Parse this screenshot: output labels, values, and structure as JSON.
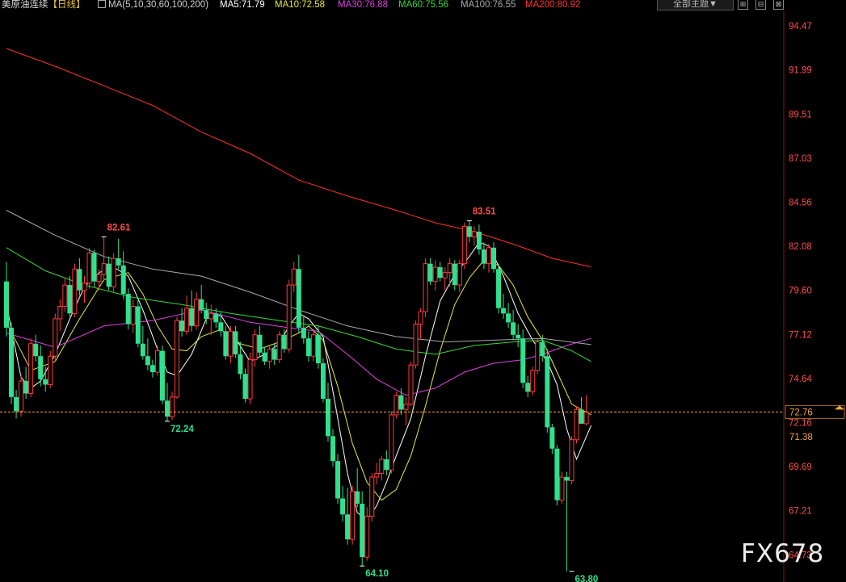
{
  "header": {
    "symbol": "美原油连续",
    "period": "【日线】",
    "ma_params": "MA(5,10,30,60,100,200)",
    "ma_values": [
      {
        "label": "MA5:71.79",
        "color": "#ffffff"
      },
      {
        "label": "MA10:72.58",
        "color": "#e8e83a"
      },
      {
        "label": "MA30:76.88",
        "color": "#e040e0"
      },
      {
        "label": "MA60:75.56",
        "color": "#38d838"
      },
      {
        "label": "MA100:76.55",
        "color": "#aaaaaa"
      },
      {
        "label": "MA200:80.92",
        "color": "#ff3030"
      }
    ],
    "theme_button": "全部主题▼",
    "window_buttons": [
      {
        "name": "expand-icon",
        "glyph": "⊞"
      },
      {
        "name": "minimize-window-icon",
        "glyph": "⊟"
      },
      {
        "name": "close-window-icon",
        "glyph": "⊠"
      }
    ]
  },
  "watermark": "FX678",
  "chart_data": {
    "type": "candlestick",
    "title": "美原油连续【日线】",
    "y_ticks": [
      94.47,
      91.99,
      89.51,
      87.03,
      84.56,
      82.08,
      79.6,
      77.12,
      74.64,
      72.16,
      69.69,
      67.21,
      64.73
    ],
    "ylim": [
      63.2,
      95.2
    ],
    "current_price": 72.76,
    "price_line_label": "72.76",
    "marker_price": 71.38,
    "marker_label": "71.38",
    "grid": false,
    "colors": {
      "up": "#ff3b3b",
      "down": "#2fe08e",
      "current": "#f7a440",
      "axis_text": "#ff4b4b"
    },
    "annotations": [
      {
        "label": "82.61",
        "index": 20,
        "value": 82.61,
        "kind": "high"
      },
      {
        "label": "72.24",
        "index": 33,
        "value": 72.24,
        "kind": "low"
      },
      {
        "label": "64.10",
        "index": 73,
        "value": 64.1,
        "kind": "low"
      },
      {
        "label": "83.51",
        "index": 95,
        "value": 83.51,
        "kind": "high"
      },
      {
        "label": "63.80",
        "index": 116,
        "value": 63.8,
        "kind": "low"
      }
    ],
    "ohlc": [
      [
        80.1,
        81.2,
        77.0,
        77.5
      ],
      [
        77.5,
        77.8,
        73.2,
        73.6
      ],
      [
        73.6,
        74.0,
        72.4,
        72.8
      ],
      [
        72.8,
        74.9,
        72.5,
        74.5
      ],
      [
        74.5,
        75.3,
        73.5,
        73.8
      ],
      [
        73.8,
        76.9,
        73.6,
        76.6
      ],
      [
        76.6,
        77.1,
        75.6,
        75.9
      ],
      [
        75.9,
        76.5,
        74.2,
        74.6
      ],
      [
        74.6,
        75.3,
        73.9,
        74.3
      ],
      [
        74.3,
        76.2,
        74.1,
        75.9
      ],
      [
        75.9,
        78.3,
        75.6,
        78.0
      ],
      [
        78.0,
        79.1,
        77.3,
        78.7
      ],
      [
        78.7,
        80.3,
        78.4,
        79.9
      ],
      [
        79.9,
        80.4,
        78.1,
        78.3
      ],
      [
        78.3,
        81.1,
        78.1,
        80.8
      ],
      [
        80.8,
        81.4,
        79.3,
        79.6
      ],
      [
        79.6,
        80.4,
        78.9,
        80.0
      ],
      [
        80.0,
        82.0,
        79.7,
        81.7
      ],
      [
        81.7,
        81.9,
        79.8,
        80.1
      ],
      [
        80.1,
        80.8,
        79.6,
        80.5
      ],
      [
        80.5,
        82.61,
        80.1,
        81.1
      ],
      [
        81.1,
        81.5,
        79.6,
        79.8
      ],
      [
        79.8,
        81.7,
        79.5,
        81.4
      ],
      [
        81.4,
        82.5,
        80.8,
        81.0
      ],
      [
        81.0,
        81.8,
        79.1,
        79.4
      ],
      [
        79.4,
        79.7,
        77.4,
        77.7
      ],
      [
        77.7,
        79.1,
        77.2,
        78.7
      ],
      [
        78.7,
        79.2,
        76.4,
        76.6
      ],
      [
        76.6,
        77.6,
        75.7,
        75.9
      ],
      [
        75.9,
        76.9,
        75.1,
        75.4
      ],
      [
        75.4,
        75.7,
        74.7,
        75.0
      ],
      [
        75.0,
        76.5,
        74.8,
        76.2
      ],
      [
        76.2,
        76.5,
        73.2,
        73.4
      ],
      [
        73.4,
        74.4,
        72.24,
        72.5
      ],
      [
        72.5,
        73.9,
        72.3,
        73.6
      ],
      [
        73.6,
        78.1,
        73.5,
        77.9
      ],
      [
        77.9,
        78.6,
        77.0,
        77.3
      ],
      [
        77.3,
        79.3,
        77.1,
        78.6
      ],
      [
        78.6,
        79.6,
        77.3,
        77.6
      ],
      [
        77.6,
        79.5,
        77.4,
        79.1
      ],
      [
        79.1,
        79.9,
        78.3,
        78.5
      ],
      [
        78.5,
        78.9,
        77.7,
        78.0
      ],
      [
        78.0,
        78.8,
        77.1,
        78.3
      ],
      [
        78.3,
        78.6,
        77.5,
        77.8
      ],
      [
        77.8,
        78.4,
        77.0,
        77.3
      ],
      [
        77.3,
        77.6,
        75.7,
        75.9
      ],
      [
        75.9,
        77.6,
        75.5,
        77.3
      ],
      [
        77.3,
        77.6,
        75.8,
        76.0
      ],
      [
        76.0,
        76.7,
        74.6,
        74.9
      ],
      [
        74.9,
        75.2,
        73.3,
        73.5
      ],
      [
        73.5,
        76.1,
        73.2,
        75.7
      ],
      [
        75.7,
        77.4,
        75.3,
        77.1
      ],
      [
        77.1,
        77.6,
        75.9,
        76.1
      ],
      [
        76.1,
        76.4,
        75.4,
        75.6
      ],
      [
        75.6,
        76.5,
        75.2,
        76.3
      ],
      [
        76.3,
        76.6,
        75.4,
        75.7
      ],
      [
        75.7,
        77.3,
        75.5,
        77.1
      ],
      [
        77.1,
        77.4,
        76.1,
        76.3
      ],
      [
        76.3,
        80.2,
        76.1,
        79.9
      ],
      [
        79.9,
        81.2,
        79.5,
        80.8
      ],
      [
        80.8,
        81.6,
        77.2,
        77.5
      ],
      [
        77.5,
        78.1,
        76.6,
        76.9
      ],
      [
        76.9,
        77.3,
        75.6,
        75.9
      ],
      [
        75.9,
        77.4,
        75.6,
        77.1
      ],
      [
        77.1,
        77.6,
        75.2,
        75.5
      ],
      [
        75.5,
        75.8,
        73.3,
        73.5
      ],
      [
        73.5,
        74.4,
        71.1,
        71.4
      ],
      [
        71.4,
        71.8,
        69.7,
        70.0
      ],
      [
        70.0,
        70.4,
        67.6,
        67.9
      ],
      [
        67.9,
        68.6,
        66.6,
        67.0
      ],
      [
        67.0,
        68.5,
        65.3,
        65.6
      ],
      [
        65.6,
        68.6,
        65.3,
        68.3
      ],
      [
        68.3,
        69.6,
        67.4,
        67.6
      ],
      [
        67.6,
        68.3,
        64.1,
        64.6
      ],
      [
        64.6,
        67.4,
        64.4,
        66.9
      ],
      [
        66.9,
        69.3,
        66.6,
        69.1
      ],
      [
        69.1,
        69.9,
        68.7,
        69.3
      ],
      [
        69.3,
        70.3,
        68.9,
        70.1
      ],
      [
        70.1,
        70.6,
        69.2,
        69.5
      ],
      [
        69.5,
        72.8,
        69.3,
        72.6
      ],
      [
        72.6,
        73.9,
        72.4,
        73.7
      ],
      [
        73.7,
        74.1,
        72.6,
        72.9
      ],
      [
        72.9,
        73.6,
        72.0,
        73.2
      ],
      [
        73.2,
        75.6,
        73.1,
        75.4
      ],
      [
        75.4,
        77.9,
        75.2,
        77.7
      ],
      [
        77.7,
        78.6,
        76.9,
        78.4
      ],
      [
        78.4,
        81.4,
        78.1,
        81.1
      ],
      [
        81.1,
        81.4,
        79.9,
        80.1
      ],
      [
        80.1,
        81.3,
        79.6,
        80.9
      ],
      [
        80.9,
        81.2,
        80.1,
        80.3
      ],
      [
        80.3,
        80.9,
        79.6,
        80.6
      ],
      [
        80.6,
        81.4,
        79.8,
        81.1
      ],
      [
        81.1,
        81.3,
        79.6,
        79.9
      ],
      [
        79.9,
        81.3,
        79.5,
        81.1
      ],
      [
        81.1,
        83.4,
        80.8,
        83.2
      ],
      [
        83.2,
        83.51,
        82.3,
        82.6
      ],
      [
        82.6,
        83.2,
        82.1,
        82.9
      ],
      [
        82.9,
        83.3,
        81.6,
        81.9
      ],
      [
        81.9,
        82.3,
        80.8,
        81.1
      ],
      [
        81.1,
        82.2,
        80.6,
        82.0
      ],
      [
        82.0,
        82.3,
        80.6,
        80.8
      ],
      [
        80.8,
        81.1,
        78.3,
        78.6
      ],
      [
        78.6,
        79.4,
        78.0,
        78.3
      ],
      [
        78.3,
        78.9,
        77.5,
        77.8
      ],
      [
        77.8,
        78.5,
        76.8,
        77.1
      ],
      [
        77.1,
        77.7,
        76.4,
        76.9
      ],
      [
        76.9,
        77.4,
        74.1,
        74.4
      ],
      [
        74.4,
        74.8,
        73.6,
        73.9
      ],
      [
        73.9,
        75.3,
        73.7,
        75.1
      ],
      [
        75.1,
        76.9,
        74.9,
        76.7
      ],
      [
        76.7,
        77.1,
        75.6,
        75.9
      ],
      [
        75.9,
        76.3,
        71.6,
        71.9
      ],
      [
        71.9,
        72.1,
        70.4,
        70.7
      ],
      [
        70.7,
        70.9,
        67.5,
        67.8
      ],
      [
        67.8,
        69.4,
        67.6,
        69.1
      ],
      [
        69.1,
        69.4,
        63.8,
        68.9
      ],
      [
        68.9,
        71.4,
        68.7,
        71.2
      ],
      [
        71.2,
        73.1,
        71.0,
        72.9
      ],
      [
        72.9,
        73.6,
        72.4,
        72.1
      ],
      [
        72.1,
        73.7,
        72.0,
        72.76
      ]
    ],
    "ma": [
      {
        "name": "MA5",
        "color": "#ffffff",
        "values": [
          [
            0,
            78.8
          ],
          [
            3,
            74.7
          ],
          [
            5,
            74.1
          ],
          [
            7,
            74.5
          ],
          [
            10,
            76.0
          ],
          [
            13,
            78.0
          ],
          [
            16,
            79.8
          ],
          [
            19,
            80.6
          ],
          [
            22,
            80.9
          ],
          [
            25,
            80.4
          ],
          [
            28,
            78.5
          ],
          [
            31,
            76.3
          ],
          [
            33,
            75.0
          ],
          [
            35,
            74.8
          ],
          [
            38,
            76.0
          ],
          [
            41,
            78.0
          ],
          [
            44,
            78.2
          ],
          [
            47,
            76.9
          ],
          [
            50,
            75.6
          ],
          [
            53,
            76.0
          ],
          [
            56,
            76.6
          ],
          [
            58,
            77.6
          ],
          [
            60,
            78.3
          ],
          [
            62,
            78.0
          ],
          [
            65,
            77.0
          ],
          [
            68,
            72.4
          ],
          [
            70,
            69.3
          ],
          [
            72,
            67.1
          ],
          [
            74,
            66.7
          ],
          [
            76,
            67.5
          ],
          [
            78,
            68.8
          ],
          [
            80,
            70.3
          ],
          [
            83,
            72.4
          ],
          [
            86,
            75.9
          ],
          [
            89,
            79.0
          ],
          [
            92,
            80.5
          ],
          [
            95,
            81.5
          ],
          [
            97,
            82.3
          ],
          [
            99,
            82.1
          ],
          [
            102,
            80.4
          ],
          [
            105,
            78.3
          ],
          [
            108,
            76.8
          ],
          [
            111,
            75.6
          ],
          [
            113,
            74.3
          ],
          [
            115,
            71.8
          ],
          [
            117,
            70.1
          ],
          [
            120,
            72.0
          ]
        ]
      },
      {
        "name": "MA10",
        "color": "#e8e83a",
        "values": [
          [
            0,
            77.8
          ],
          [
            5,
            75.1
          ],
          [
            10,
            75.6
          ],
          [
            15,
            78.0
          ],
          [
            20,
            80.2
          ],
          [
            25,
            80.6
          ],
          [
            28,
            79.4
          ],
          [
            31,
            77.6
          ],
          [
            34,
            76.3
          ],
          [
            37,
            76.2
          ],
          [
            40,
            77.0
          ],
          [
            44,
            77.4
          ],
          [
            48,
            76.6
          ],
          [
            52,
            76.3
          ],
          [
            56,
            76.7
          ],
          [
            60,
            77.2
          ],
          [
            62,
            77.6
          ],
          [
            65,
            76.8
          ],
          [
            68,
            74.2
          ],
          [
            71,
            71.0
          ],
          [
            74,
            68.8
          ],
          [
            77,
            67.8
          ],
          [
            80,
            68.4
          ],
          [
            83,
            70.3
          ],
          [
            86,
            73.1
          ],
          [
            89,
            76.2
          ],
          [
            92,
            78.8
          ],
          [
            95,
            80.3
          ],
          [
            98,
            81.3
          ],
          [
            101,
            81.0
          ],
          [
            104,
            79.9
          ],
          [
            107,
            78.1
          ],
          [
            110,
            76.8
          ],
          [
            113,
            75.0
          ],
          [
            116,
            73.2
          ],
          [
            120,
            72.6
          ]
        ]
      },
      {
        "name": "MA30",
        "color": "#e040e0",
        "values": [
          [
            0,
            77.2
          ],
          [
            10,
            76.4
          ],
          [
            20,
            77.6
          ],
          [
            30,
            77.9
          ],
          [
            40,
            78.5
          ],
          [
            50,
            77.8
          ],
          [
            58,
            77.5
          ],
          [
            64,
            77.3
          ],
          [
            70,
            76.0
          ],
          [
            76,
            74.6
          ],
          [
            82,
            73.7
          ],
          [
            88,
            74.1
          ],
          [
            94,
            75.0
          ],
          [
            100,
            75.5
          ],
          [
            106,
            75.7
          ],
          [
            110,
            76.0
          ],
          [
            115,
            76.5
          ],
          [
            120,
            76.9
          ]
        ]
      },
      {
        "name": "MA60",
        "color": "#38d838",
        "values": [
          [
            0,
            82.0
          ],
          [
            8,
            80.7
          ],
          [
            16,
            79.9
          ],
          [
            26,
            79.2
          ],
          [
            36,
            78.8
          ],
          [
            46,
            78.3
          ],
          [
            56,
            77.9
          ],
          [
            64,
            77.6
          ],
          [
            72,
            77.0
          ],
          [
            80,
            76.3
          ],
          [
            88,
            76.0
          ],
          [
            96,
            76.5
          ],
          [
            104,
            76.7
          ],
          [
            110,
            76.8
          ],
          [
            116,
            76.2
          ],
          [
            120,
            75.6
          ]
        ]
      },
      {
        "name": "MA100",
        "color": "#aaaaaa",
        "values": [
          [
            0,
            84.1
          ],
          [
            10,
            82.7
          ],
          [
            20,
            81.5
          ],
          [
            30,
            80.8
          ],
          [
            40,
            80.4
          ],
          [
            50,
            79.5
          ],
          [
            60,
            78.5
          ],
          [
            70,
            77.6
          ],
          [
            80,
            77.0
          ],
          [
            90,
            76.7
          ],
          [
            100,
            76.8
          ],
          [
            110,
            76.9
          ],
          [
            120,
            76.55
          ]
        ]
      },
      {
        "name": "MA200",
        "color": "#ff3030",
        "values": [
          [
            0,
            93.2
          ],
          [
            10,
            92.2
          ],
          [
            20,
            91.1
          ],
          [
            30,
            90.0
          ],
          [
            40,
            88.5
          ],
          [
            50,
            87.3
          ],
          [
            60,
            85.8
          ],
          [
            70,
            84.9
          ],
          [
            80,
            84.1
          ],
          [
            88,
            83.4
          ],
          [
            96,
            82.9
          ],
          [
            104,
            82.2
          ],
          [
            112,
            81.4
          ],
          [
            120,
            80.92
          ]
        ]
      }
    ]
  }
}
